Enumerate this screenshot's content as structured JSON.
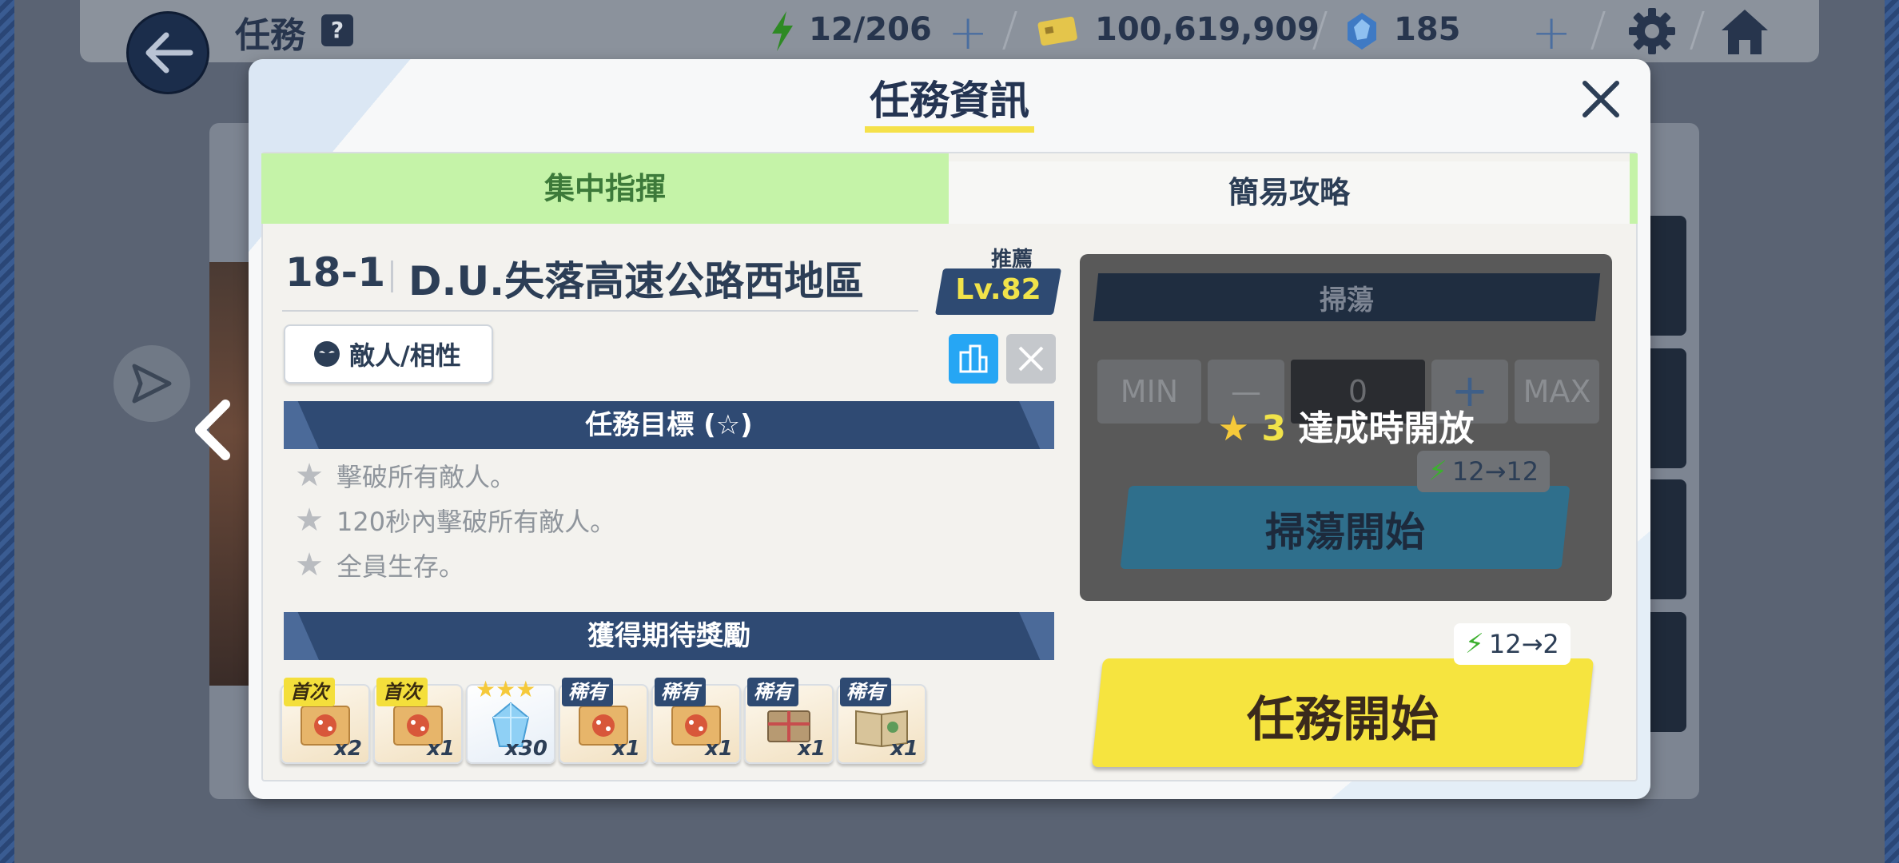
{
  "topbar": {
    "title": "任務",
    "help": "?",
    "stamina": "12/206",
    "credits": "100,619,909",
    "gems": "185",
    "plus": "+"
  },
  "modal": {
    "title": "任務資訊",
    "tabs": [
      {
        "label": "集中指揮",
        "active": true
      },
      {
        "label": "簡易攻略",
        "active": false
      }
    ],
    "stage_number": "18-1",
    "stage_name": "D.U.失落高速公路西地區",
    "recommended_label": "推薦",
    "recommended_level": "Lv.82",
    "enemy_button": "敵人/相性",
    "objectives_header": "任務目標 (☆)",
    "objectives": [
      "擊破所有敵人。",
      "120秒內擊破所有敵人。",
      "全員生存。"
    ],
    "rewards_header": "獲得期待獎勵",
    "rewards": [
      {
        "tag": "首次",
        "tag_type": "first",
        "count": "x2",
        "icon": "pizza-box-icon"
      },
      {
        "tag": "首次",
        "tag_type": "first",
        "count": "x1",
        "icon": "pizza-box-icon"
      },
      {
        "tag": "",
        "tag_type": "stars",
        "count": "x30",
        "icon": "crystal-icon"
      },
      {
        "tag": "稀有",
        "tag_type": "rare",
        "count": "x1",
        "icon": "pizza-box-icon"
      },
      {
        "tag": "稀有",
        "tag_type": "rare",
        "count": "x1",
        "icon": "pizza-box-icon"
      },
      {
        "tag": "稀有",
        "tag_type": "rare",
        "count": "x1",
        "icon": "book-bundle-icon"
      },
      {
        "tag": "稀有",
        "tag_type": "rare",
        "count": "x1",
        "icon": "open-book-icon"
      }
    ],
    "sweep": {
      "header": "掃蕩",
      "min": "MIN",
      "minus": "—",
      "count": "0",
      "plus": "+",
      "max": "MAX",
      "unlock_stars": "3",
      "unlock_text": "達成時開放",
      "cost": "12",
      "cost_after": "12",
      "start_label": "掃蕩開始"
    },
    "mission": {
      "cost": "12",
      "cost_after": "2",
      "start_label": "任務開始"
    }
  },
  "colors": {
    "accent_yellow": "#f6e43f",
    "active_tab": "#c5f3a8",
    "section_bar": "#2f4a73",
    "stamina_green": "#3cb02e"
  }
}
